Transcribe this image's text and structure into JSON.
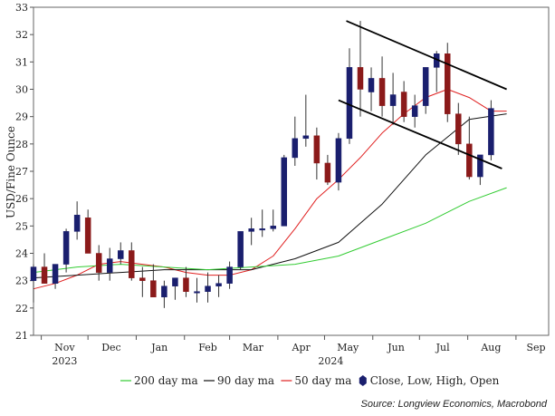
{
  "chart_data": {
    "type": "candlestick",
    "ylabel": "USD/Fine Ounce",
    "ylim": [
      21,
      33
    ],
    "yticks": [
      21,
      22,
      23,
      24,
      25,
      26,
      27,
      28,
      29,
      30,
      31,
      32,
      33
    ],
    "xlim": [
      "2023-10-27",
      "2024-09-22"
    ],
    "month_labels": [
      {
        "label": "Nov",
        "date": "2023-11-01"
      },
      {
        "label": "Dec",
        "date": "2023-12-01"
      },
      {
        "label": "Jan",
        "date": "2024-01-01"
      },
      {
        "label": "Feb",
        "date": "2024-02-01"
      },
      {
        "label": "Mar",
        "date": "2024-03-01"
      },
      {
        "label": "Apr",
        "date": "2024-04-01"
      },
      {
        "label": "May",
        "date": "2024-05-01"
      },
      {
        "label": "Jun",
        "date": "2024-06-01"
      },
      {
        "label": "Jul",
        "date": "2024-07-01"
      },
      {
        "label": "Aug",
        "date": "2024-08-01"
      },
      {
        "label": "Sep",
        "date": "2024-09-01"
      }
    ],
    "year_labels": [
      {
        "label": "2023",
        "date": "2023-11-16"
      },
      {
        "label": "2024",
        "date": "2024-05-05"
      }
    ],
    "colors": {
      "up": "#1a1f6e",
      "down": "#8b1a1a",
      "ma200": "#33cc33",
      "ma90": "#111111",
      "ma50": "#e02020",
      "trendline": "#000000",
      "axis": "#555555"
    },
    "series": [
      {
        "name": "Close, Low, High, Open",
        "kind": "ohlc",
        "date": [
          "2023-10-27",
          "2023-11-03",
          "2023-11-10",
          "2023-11-17",
          "2023-11-24",
          "2023-12-01",
          "2023-12-08",
          "2023-12-15",
          "2023-12-22",
          "2023-12-29",
          "2024-01-05",
          "2024-01-12",
          "2024-01-19",
          "2024-01-26",
          "2024-02-02",
          "2024-02-09",
          "2024-02-16",
          "2024-02-23",
          "2024-03-01",
          "2024-03-08",
          "2024-03-15",
          "2024-03-22",
          "2024-03-29",
          "2024-04-05",
          "2024-04-12",
          "2024-04-19",
          "2024-04-26",
          "2024-05-03",
          "2024-05-10",
          "2024-05-17",
          "2024-05-24",
          "2024-05-31",
          "2024-06-07",
          "2024-06-14",
          "2024-06-21",
          "2024-06-28",
          "2024-07-05",
          "2024-07-12",
          "2024-07-19",
          "2024-07-26",
          "2024-08-02",
          "2024-08-09",
          "2024-08-16"
        ],
        "open": [
          23.0,
          23.5,
          22.9,
          23.6,
          24.8,
          25.3,
          24.0,
          23.3,
          23.8,
          24.1,
          23.1,
          23.0,
          22.4,
          22.8,
          23.1,
          22.6,
          22.6,
          22.8,
          22.9,
          23.5,
          24.8,
          24.9,
          24.9,
          25.0,
          27.5,
          28.2,
          28.3,
          27.3,
          26.6,
          28.2,
          30.8,
          29.9,
          30.4,
          29.4,
          29.9,
          29.0,
          29.4,
          30.8,
          31.3,
          29.1,
          28.0,
          26.8,
          27.6
        ],
        "high": [
          23.6,
          24.0,
          23.6,
          24.9,
          25.9,
          25.6,
          24.3,
          24.2,
          24.4,
          24.4,
          23.5,
          23.6,
          23.0,
          23.1,
          23.5,
          23.1,
          23.3,
          23.2,
          23.7,
          24.8,
          25.3,
          25.6,
          25.6,
          27.6,
          29.0,
          29.8,
          28.6,
          27.6,
          28.4,
          31.5,
          32.5,
          30.8,
          31.2,
          30.6,
          30.3,
          29.8,
          30.5,
          31.4,
          31.7,
          29.5,
          29.0,
          27.5,
          29.6
        ],
        "low": [
          22.2,
          22.9,
          22.7,
          23.3,
          24.5,
          24.0,
          23.0,
          23.0,
          23.6,
          23.0,
          22.4,
          22.5,
          22.0,
          22.3,
          22.4,
          22.2,
          22.2,
          22.4,
          22.7,
          23.4,
          24.3,
          24.6,
          24.8,
          25.0,
          27.2,
          27.9,
          26.7,
          26.5,
          26.3,
          28.0,
          29.0,
          29.2,
          29.0,
          28.7,
          28.8,
          28.6,
          29.1,
          29.9,
          28.8,
          27.6,
          26.7,
          26.5,
          27.4
        ],
        "close": [
          23.5,
          22.9,
          23.6,
          24.8,
          25.4,
          24.0,
          23.3,
          23.8,
          24.1,
          23.1,
          23.0,
          22.4,
          22.8,
          23.1,
          22.6,
          22.6,
          22.8,
          22.9,
          23.5,
          24.8,
          24.9,
          24.9,
          25.0,
          27.5,
          28.2,
          28.3,
          27.3,
          26.6,
          28.2,
          30.8,
          30.0,
          30.4,
          29.4,
          29.8,
          29.0,
          29.4,
          30.8,
          31.3,
          29.1,
          28.0,
          26.8,
          27.6,
          29.3
        ]
      },
      {
        "name": "50 day ma",
        "kind": "line",
        "date": [
          "2023-10-27",
          "2023-11-10",
          "2023-11-24",
          "2023-12-08",
          "2023-12-22",
          "2024-01-05",
          "2024-01-19",
          "2024-02-02",
          "2024-02-16",
          "2024-03-01",
          "2024-03-15",
          "2024-03-29",
          "2024-04-12",
          "2024-04-26",
          "2024-05-10",
          "2024-05-24",
          "2024-06-07",
          "2024-06-21",
          "2024-07-05",
          "2024-07-19",
          "2024-08-02",
          "2024-08-16",
          "2024-08-26"
        ],
        "values": [
          22.7,
          22.9,
          23.2,
          23.6,
          23.7,
          23.6,
          23.5,
          23.3,
          23.2,
          23.2,
          23.4,
          23.9,
          24.9,
          26.0,
          26.7,
          27.5,
          28.4,
          29.1,
          29.7,
          30.0,
          29.7,
          29.2,
          29.2
        ]
      },
      {
        "name": "90 day ma",
        "kind": "line",
        "date": [
          "2023-10-27",
          "2023-11-24",
          "2023-12-22",
          "2024-01-19",
          "2024-02-16",
          "2024-03-15",
          "2024-04-12",
          "2024-05-10",
          "2024-06-07",
          "2024-07-05",
          "2024-08-02",
          "2024-08-26"
        ],
        "values": [
          23.1,
          23.2,
          23.3,
          23.4,
          23.4,
          23.4,
          23.8,
          24.4,
          25.8,
          27.6,
          28.9,
          29.1
        ]
      },
      {
        "name": "200 day ma",
        "kind": "line",
        "date": [
          "2023-10-27",
          "2023-11-24",
          "2023-12-22",
          "2024-01-19",
          "2024-02-16",
          "2024-03-15",
          "2024-04-12",
          "2024-05-10",
          "2024-06-07",
          "2024-07-05",
          "2024-08-02",
          "2024-08-26"
        ],
        "values": [
          23.3,
          23.5,
          23.6,
          23.5,
          23.4,
          23.5,
          23.6,
          23.9,
          24.5,
          25.1,
          25.9,
          26.4
        ]
      },
      {
        "name": "trendline-upper",
        "kind": "line",
        "date": [
          "2024-05-15",
          "2024-08-26"
        ],
        "values": [
          32.5,
          30.0
        ]
      },
      {
        "name": "trendline-lower",
        "kind": "line",
        "date": [
          "2024-05-10",
          "2024-08-23"
        ],
        "values": [
          29.6,
          27.1
        ]
      }
    ],
    "legend": {
      "placement": "bottom",
      "entries": [
        {
          "label": "200 day ma",
          "color": "#33cc33",
          "symbol": "line"
        },
        {
          "label": "90 day ma",
          "color": "#111111",
          "symbol": "line"
        },
        {
          "label": "50 day ma",
          "color": "#e02020",
          "symbol": "line"
        },
        {
          "label": "Close, Low, High, Open",
          "color": "#1a1f6e",
          "symbol": "candle"
        }
      ]
    },
    "source": "Source: Longview Economics, Macrobond",
    "grid": false
  }
}
